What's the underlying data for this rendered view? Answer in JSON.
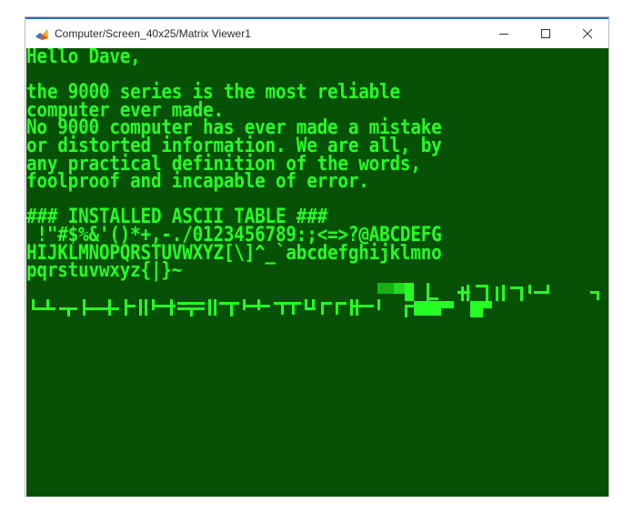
{
  "window": {
    "title": "Computer/Screen_40x25/Matrix Viewer1",
    "controls": {
      "minimize_icon": "minimize-icon",
      "maximize_icon": "maximize-icon",
      "close_icon": "close-icon"
    },
    "accent_color": "#1f6fd1"
  },
  "screen": {
    "background_color": "#075106",
    "text_color": "#25ff25",
    "lines": [
      "Hello Dave,",
      "",
      "the 9000 series is the most reliable",
      "computer ever made.",
      "No 9000 computer has ever made a mistake",
      "or distorted information. We are all, by",
      "any practical definition of the words,",
      "foolproof and incapable of error.",
      "",
      "### INSTALLED ASCII TABLE ###",
      " !\"#$%&'()*+,-./0123456789:;<=>?@ABCDEFG",
      "HIJKLMNOPQRSTUVWXYZ[\\]^_`abcdefghijklmno",
      "pqrstuvwxyz{|}~"
    ],
    "graphics_row_1": "▓▓▒▒▒█▌ ▐ ╣┼╥╕╢╟╗╜╝ ╕",
    "graphics_row_2": "┴┴┬├─┼╞╟╚╔╩╦╠═╬╧╨╤╥╙╘╒╓╫╪┘┌█▄▌▐▀"
  }
}
